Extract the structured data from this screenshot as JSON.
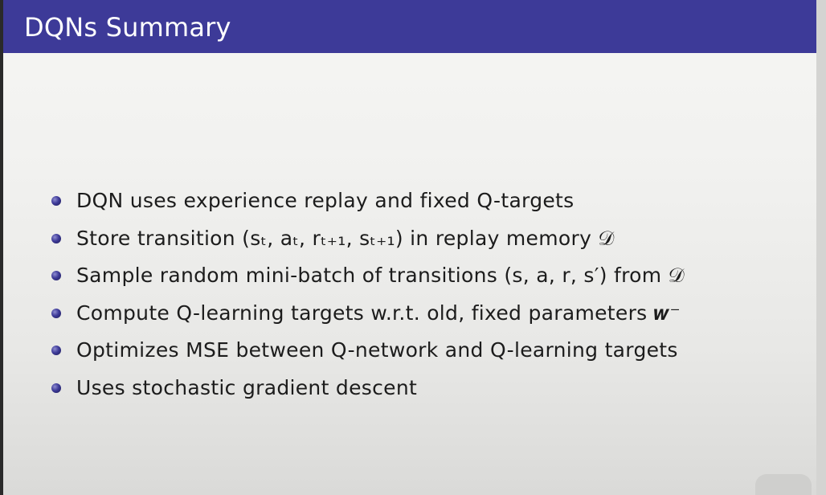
{
  "slide": {
    "title": "DQNs Summary",
    "bullets": [
      "DQN uses experience replay and fixed Q-targets",
      "Store transition (sₜ, aₜ, rₜ₊₁, sₜ₊₁) in replay memory 𝒟",
      "Sample random mini-batch of transitions (s, a, r, s′) from 𝒟",
      "Compute Q-learning targets w.r.t. old, fixed parameters 𝒘⁻",
      "Optimizes MSE between Q-network and Q-learning targets",
      "Uses stochastic gradient descent"
    ]
  },
  "colors": {
    "title_bar": "#3d3a98",
    "title_text": "#ffffff",
    "bullet": "#3d3a98",
    "body_text": "#1c1c1c"
  }
}
